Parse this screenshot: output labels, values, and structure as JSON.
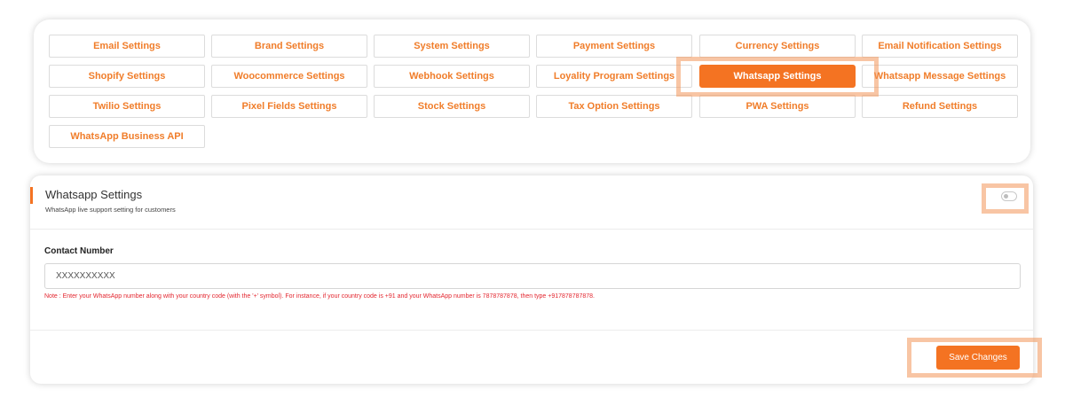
{
  "tabs": [
    {
      "label": "Email Settings"
    },
    {
      "label": "Brand Settings"
    },
    {
      "label": "System Settings"
    },
    {
      "label": "Payment Settings"
    },
    {
      "label": "Currency Settings"
    },
    {
      "label": "Email Notification Settings"
    },
    {
      "label": "Shopify Settings"
    },
    {
      "label": "Woocommerce Settings"
    },
    {
      "label": "Webhook Settings"
    },
    {
      "label": "Loyality Program Settings"
    },
    {
      "label": "Whatsapp Settings",
      "active": true
    },
    {
      "label": "Whatsapp Message Settings"
    },
    {
      "label": "Twilio Settings"
    },
    {
      "label": "Pixel Fields Settings"
    },
    {
      "label": "Stock Settings"
    },
    {
      "label": "Tax Option Settings"
    },
    {
      "label": "PWA Settings"
    },
    {
      "label": "Refund Settings"
    },
    {
      "label": "WhatsApp Business API"
    }
  ],
  "section": {
    "title": "Whatsapp Settings",
    "subtitle": "WhatsApp live support setting for customers",
    "toggle_on": false
  },
  "form": {
    "contact_label": "Contact Number",
    "contact_value": "XXXXXXXXXX",
    "note": "Note : Enter your WhatsApp number along with your country code (with the '+' symbol). For instance, if your country code is +91 and your WhatsApp number is 7878787878, then type +917878787878."
  },
  "actions": {
    "save_label": "Save Changes"
  },
  "colors": {
    "accent": "#f47322",
    "tab_text": "#f07d2a",
    "note_text": "#e3262f",
    "highlight": "#f3965a"
  }
}
